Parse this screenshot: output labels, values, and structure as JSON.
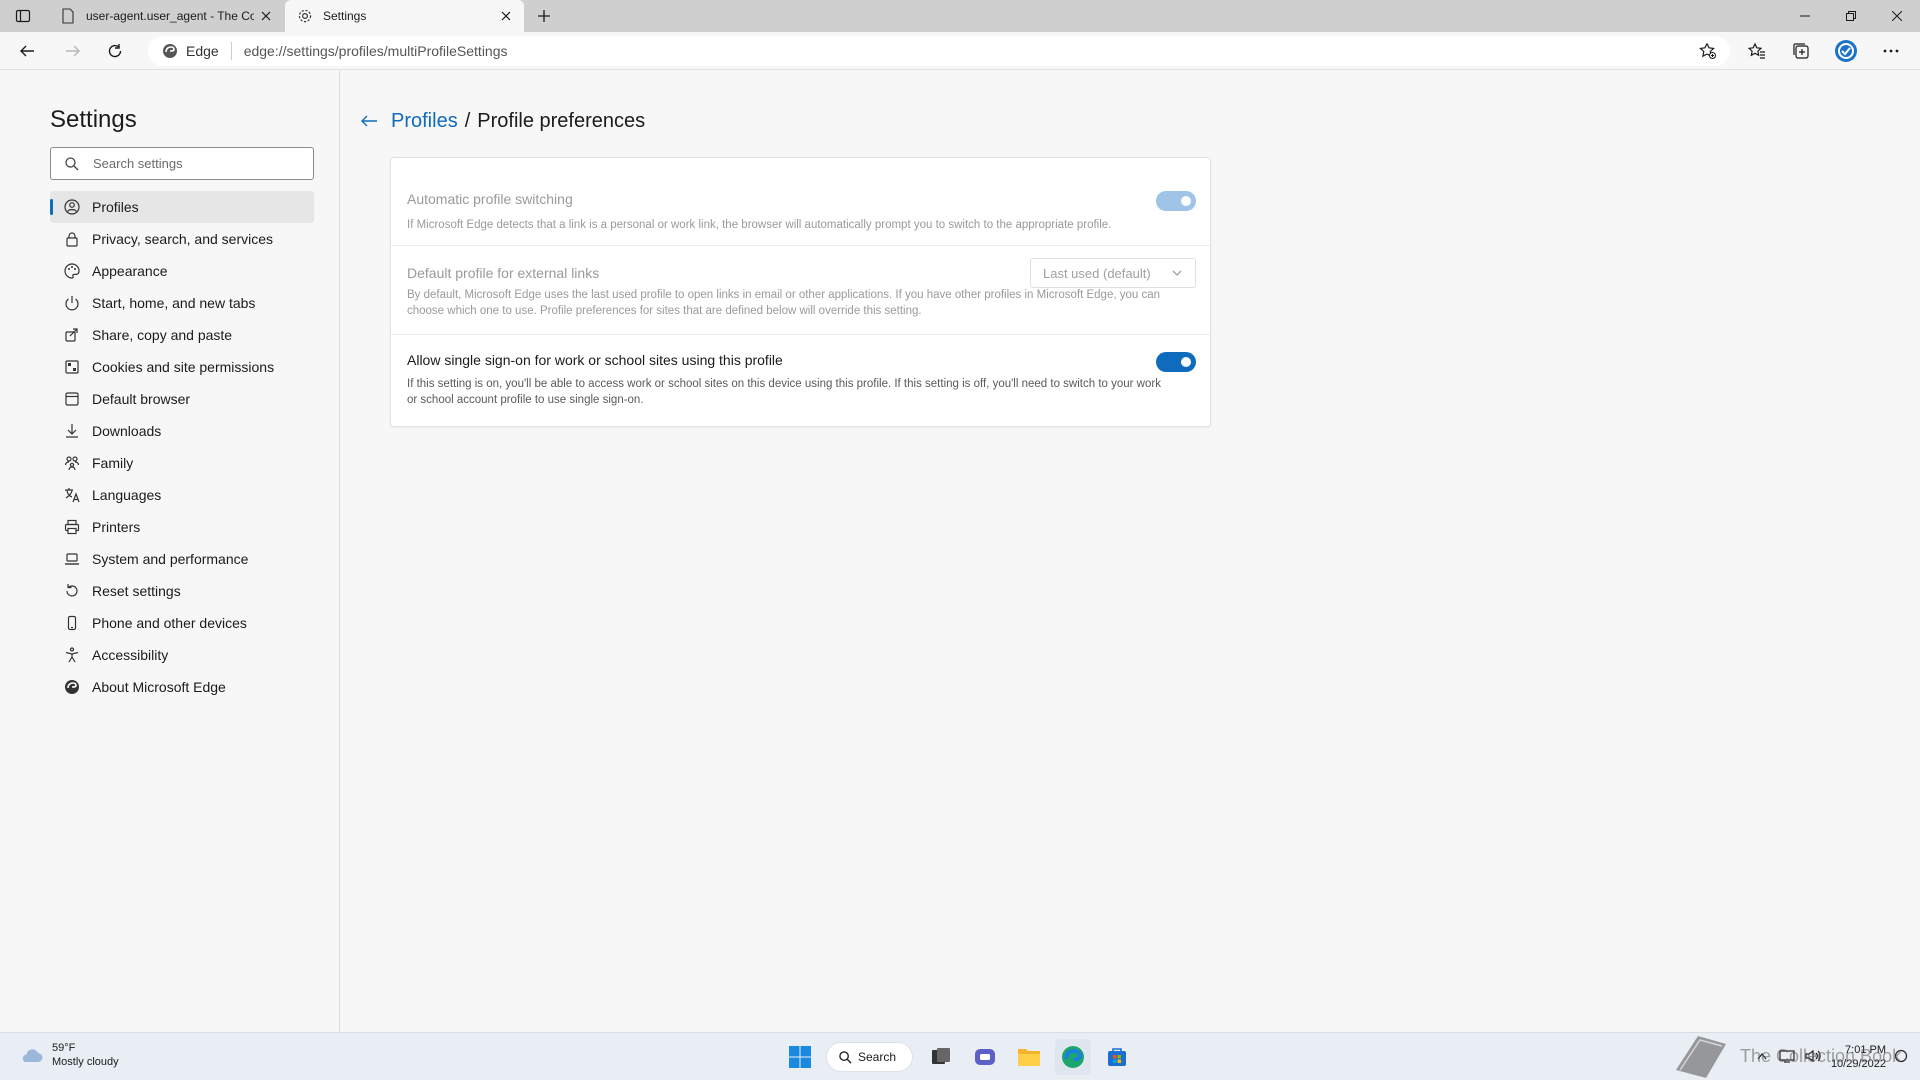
{
  "browser": {
    "tabs": [
      {
        "title": "user-agent.user_agent - The Coll",
        "active": false
      },
      {
        "title": "Settings",
        "active": true
      }
    ],
    "site_label": "Edge",
    "url": "edge://settings/profiles/multiProfileSettings"
  },
  "sidebar": {
    "title": "Settings",
    "search_placeholder": "Search settings",
    "items": [
      {
        "label": "Profiles",
        "icon": "profile-icon",
        "active": true
      },
      {
        "label": "Privacy, search, and services",
        "icon": "lock-icon"
      },
      {
        "label": "Appearance",
        "icon": "appearance-icon"
      },
      {
        "label": "Start, home, and new tabs",
        "icon": "power-icon"
      },
      {
        "label": "Share, copy and paste",
        "icon": "share-icon"
      },
      {
        "label": "Cookies and site permissions",
        "icon": "cookie-icon"
      },
      {
        "label": "Default browser",
        "icon": "browser-icon"
      },
      {
        "label": "Downloads",
        "icon": "download-icon"
      },
      {
        "label": "Family",
        "icon": "family-icon"
      },
      {
        "label": "Languages",
        "icon": "language-icon"
      },
      {
        "label": "Printers",
        "icon": "printer-icon"
      },
      {
        "label": "System and performance",
        "icon": "laptop-icon"
      },
      {
        "label": "Reset settings",
        "icon": "reset-icon"
      },
      {
        "label": "Phone and other devices",
        "icon": "phone-icon"
      },
      {
        "label": "Accessibility",
        "icon": "accessibility-icon"
      },
      {
        "label": "About Microsoft Edge",
        "icon": "edge-icon"
      }
    ]
  },
  "main": {
    "breadcrumb_link": "Profiles",
    "breadcrumb_separator": "/",
    "breadcrumb_current": "Profile preferences",
    "settings": [
      {
        "title": "Automatic profile switching",
        "description": "If Microsoft Edge detects that a link is a personal or work link, the browser will automatically prompt you to switch to the appropriate profile.",
        "control": "toggle",
        "on": true,
        "disabled": true
      },
      {
        "title": "Default profile for external links",
        "description": "By default, Microsoft Edge uses the last used profile to open links in email or other applications. If you have other profiles in Microsoft Edge, you can choose which one to use. Profile preferences for sites that are defined below will override this setting.",
        "control": "select",
        "value": "Last used (default)",
        "disabled": true
      },
      {
        "title": "Allow single sign-on for work or school sites using this profile",
        "description": "If this setting is on, you'll be able to access work or school sites on this device using this profile. If this setting is off, you'll need to switch to your work or school account profile to use single sign-on.",
        "control": "toggle",
        "on": true,
        "disabled": false
      }
    ]
  },
  "taskbar": {
    "weather_temp": "59°F",
    "weather_desc": "Mostly cloudy",
    "search_label": "Search",
    "time": "7:01 PM",
    "date": "10/29/2022",
    "watermark": "The Collection Book"
  },
  "colors": {
    "accent": "#0f6cbd",
    "accent_disabled": "#9fc4e8"
  }
}
